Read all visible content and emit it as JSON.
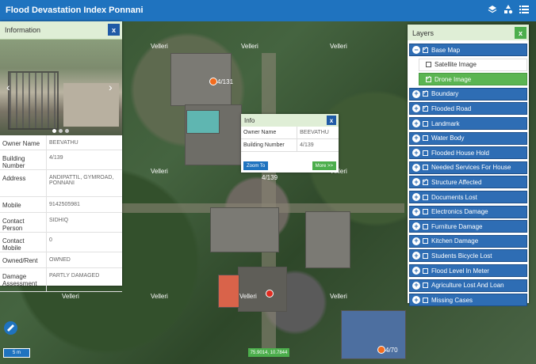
{
  "app": {
    "title": "Flood Devastation Index Ponnani",
    "icons": [
      "layers-icon",
      "shapes-icon",
      "list-icon"
    ]
  },
  "map": {
    "place_labels": [
      "Velleri",
      "Velleri",
      "Velleri",
      "Velleri",
      "Velleri",
      "Velleri",
      "Velleri",
      "Velleri",
      "Velleri"
    ],
    "marker_labels": [
      "4/131",
      "4/139",
      "4/70"
    ],
    "colors": {
      "marker_orange": "#f26b1d",
      "marker_red": "#e02b20"
    }
  },
  "info_panel": {
    "title": "Information",
    "close": "x",
    "rows": [
      {
        "key": "Owner Name",
        "value": "BEEVATHU"
      },
      {
        "key": "Building Number",
        "value": "4/139"
      },
      {
        "key": "Address",
        "value": "ANDIPATTIL, GYMROAD, PONNANI"
      },
      {
        "key": "Mobile",
        "value": "9142505981"
      },
      {
        "key": "Contact Person",
        "value": "SIDHIQ"
      },
      {
        "key": "Contact Mobile",
        "value": "0"
      },
      {
        "key": "Owned/Rent",
        "value": "OWNED"
      },
      {
        "key": "Damage Assessment",
        "value": "PARTLY DAMAGED"
      }
    ]
  },
  "popup": {
    "title": "Info",
    "close": "x",
    "rows": [
      {
        "key": "Owner Name",
        "value": "BEEVATHU"
      },
      {
        "key": "Building Number",
        "value": "4/139"
      }
    ],
    "zoom_label": "Zoom To",
    "more_label": "More >>"
  },
  "layers": {
    "title": "Layers",
    "close": "x",
    "base": {
      "label": "Base Map",
      "expander": "−",
      "checked": true,
      "sub": [
        {
          "label": "Satellite Image",
          "checked": false
        },
        {
          "label": "Drone Image",
          "checked": true
        }
      ]
    },
    "items": [
      {
        "label": "Boundary",
        "checked": true
      },
      {
        "label": "Flooded Road",
        "checked": true
      },
      {
        "label": "Landmark",
        "checked": false
      },
      {
        "label": "Water Body",
        "checked": false
      },
      {
        "label": "Flooded House Hold",
        "checked": false
      },
      {
        "label": "Needed Services For House",
        "checked": false
      },
      {
        "label": "Structure Affected",
        "checked": true
      },
      {
        "label": "Documents Lost",
        "checked": false
      },
      {
        "label": "Electronics Damage",
        "checked": false
      },
      {
        "label": "Furniture Damage",
        "checked": false
      },
      {
        "label": "Kitchen Damage",
        "checked": false
      },
      {
        "label": "Students Bicycle Lost",
        "checked": false
      },
      {
        "label": "Flood Level In Meter",
        "checked": false
      },
      {
        "label": "Agriculture Lost And Loan",
        "checked": false
      },
      {
        "label": "Missing Cases",
        "checked": false
      }
    ],
    "expander": "+"
  },
  "scale": "5 m",
  "coordinates": "75.9014, 10.7844",
  "measure_icon": "ruler-icon"
}
